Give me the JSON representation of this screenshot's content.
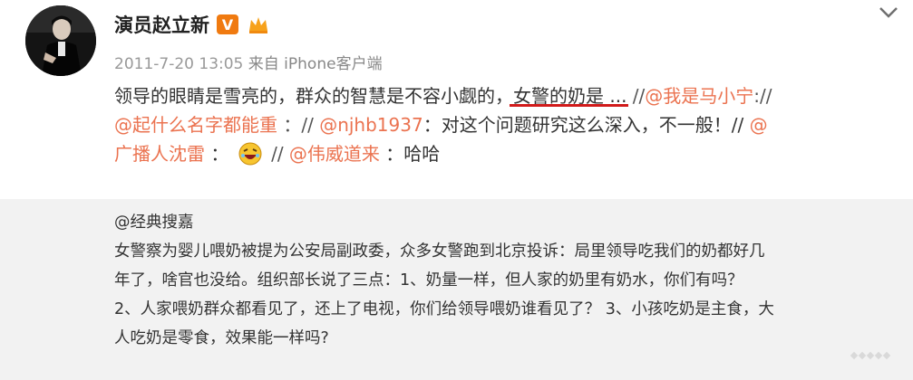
{
  "post": {
    "author": "演员赵立新",
    "verified_icon": "v-verified-badge-icon",
    "vip_icon": "vip-crown-icon",
    "avatar_icon": "user-avatar-photo",
    "timestamp": "2011-7-20 13:05",
    "source": "来自 iPhone客户端",
    "more_icon": "chevron-down-icon",
    "content": {
      "seg1": "领导的眼睛是雪亮的，群众的智慧是不容小觑的",
      "seg2": "，",
      "seg3": "女警的奶是 ...",
      "sep1": "//",
      "mention1": "@我是马小宁",
      "sep2": "://",
      "mention2": "@起什么名字都能重",
      "sep3": "：//",
      "mention3": "@njhb1937",
      "seg4": "：对这个问题研究这么深入，不一般！//",
      "mention4": "@",
      "mention5": "广播人沈雷",
      "seg5": "：",
      "emoji": "laughing-emoji-icon",
      "sep4": "//",
      "mention6": "@伟威道来",
      "seg6": "：哈哈"
    }
  },
  "repost": {
    "author": "@经典搜嘉",
    "lines": [
      "女警察为婴儿喂奶被提为公安局副政委，众多女警跑到北京投诉：局里领导吃我们的奶都好几",
      "年了，啥官也没给。组织部长说了三点：1、奶量一样，但人家的奶里有奶水，你们有吗？",
      "2、人家喂奶群众都看见了，还上了电视，你们给领导喂奶谁看见了？ 3、小孩吃奶是主食，大",
      "人吃奶是零食，效果能一样吗?"
    ]
  },
  "colors": {
    "mention": "#eb7350",
    "underline": "#d11a1a",
    "repost_bg": "#f2f2f2",
    "verified": "#f07a10"
  }
}
